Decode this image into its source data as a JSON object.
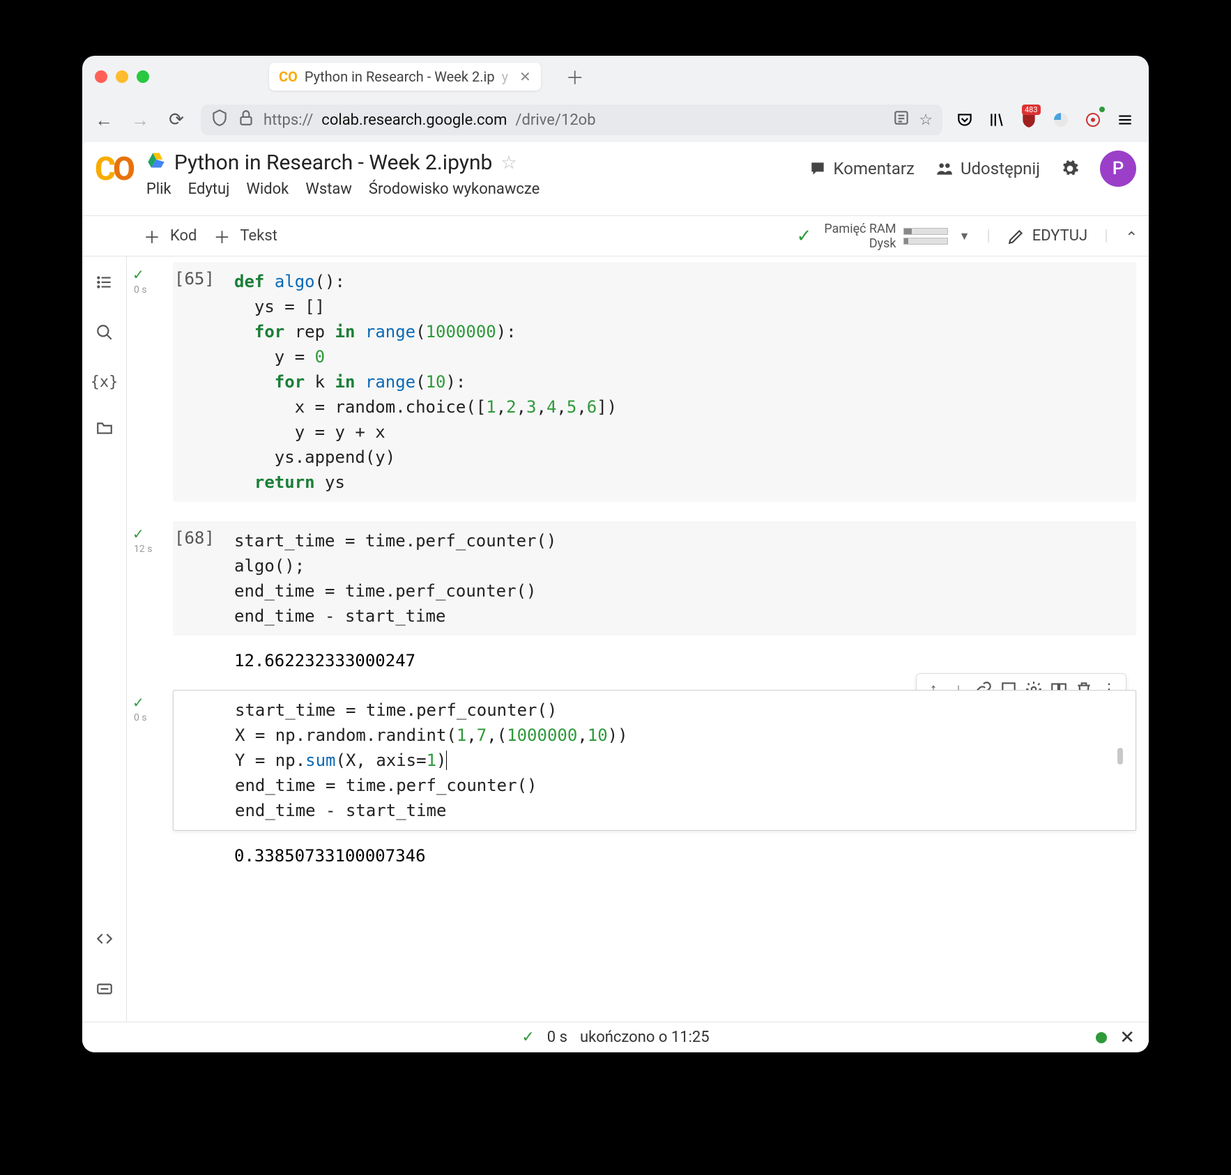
{
  "browser": {
    "tab_title": "Python in Research - Week 2.ip",
    "tab_ext": "y",
    "url_pre": "https://",
    "url_domain": "colab.research.google.com",
    "url_path": "/drive/12ob",
    "badge_count": "483"
  },
  "colab": {
    "title": "Python in Research - Week 2.ipynb",
    "menus": [
      "Plik",
      "Edytuj",
      "Widok",
      "Wstaw",
      "Środowisko wykonawcze"
    ],
    "header_actions": {
      "comment": "Komentarz",
      "share": "Udostępnij"
    },
    "avatar_letter": "P",
    "toolbar": {
      "code": "Kod",
      "text": "Tekst",
      "ram": "Pamięć RAM",
      "disk": "Dysk",
      "edit": "EDYTUJ"
    },
    "ram_fill_pct": 18,
    "disk_fill_pct": 10
  },
  "cells": [
    {
      "number": "[65]",
      "time": "0 s",
      "lines": [
        [
          [
            "kw",
            "def"
          ],
          [
            "txt",
            " "
          ],
          [
            "fn",
            "algo"
          ],
          [
            "txt",
            "():"
          ]
        ],
        [
          [
            "txt",
            "  ys = []"
          ]
        ],
        [
          [
            "txt",
            "  "
          ],
          [
            "kw",
            "for"
          ],
          [
            "txt",
            " rep "
          ],
          [
            "kw",
            "in"
          ],
          [
            "txt",
            " "
          ],
          [
            "fn",
            "range"
          ],
          [
            "txt",
            "("
          ],
          [
            "num",
            "1000000"
          ],
          [
            "txt",
            "):"
          ]
        ],
        [
          [
            "txt",
            "    y = "
          ],
          [
            "num",
            "0"
          ]
        ],
        [
          [
            "txt",
            "    "
          ],
          [
            "kw",
            "for"
          ],
          [
            "txt",
            " k "
          ],
          [
            "kw",
            "in"
          ],
          [
            "txt",
            " "
          ],
          [
            "fn",
            "range"
          ],
          [
            "txt",
            "("
          ],
          [
            "num",
            "10"
          ],
          [
            "txt",
            "):"
          ]
        ],
        [
          [
            "txt",
            "      x = random.choice(["
          ],
          [
            "num",
            "1"
          ],
          [
            "txt",
            ","
          ],
          [
            "num",
            "2"
          ],
          [
            "txt",
            ","
          ],
          [
            "num",
            "3"
          ],
          [
            "txt",
            ","
          ],
          [
            "num",
            "4"
          ],
          [
            "txt",
            ","
          ],
          [
            "num",
            "5"
          ],
          [
            "txt",
            ","
          ],
          [
            "num",
            "6"
          ],
          [
            "txt",
            "])"
          ]
        ],
        [
          [
            "txt",
            "      y = y + x"
          ]
        ],
        [
          [
            "txt",
            "    ys.append(y)"
          ]
        ],
        [
          [
            "txt",
            "  "
          ],
          [
            "kw",
            "return"
          ],
          [
            "txt",
            " ys"
          ]
        ]
      ],
      "output": null
    },
    {
      "number": "[68]",
      "time": "12 s",
      "lines": [
        [
          [
            "txt",
            "start_time = time.perf_counter()"
          ]
        ],
        [
          [
            "txt",
            "algo();"
          ]
        ],
        [
          [
            "txt",
            "end_time = time.perf_counter()"
          ]
        ],
        [
          [
            "txt",
            "end_time - start_time"
          ]
        ]
      ],
      "output": "12.662232333000247"
    },
    {
      "number": "",
      "time": "0 s",
      "active": true,
      "lines": [
        [
          [
            "txt",
            "start_time = time.perf_counter()"
          ]
        ],
        [
          [
            "txt",
            "X = np.random.randint("
          ],
          [
            "num",
            "1"
          ],
          [
            "txt",
            ","
          ],
          [
            "num",
            "7"
          ],
          [
            "txt",
            ",("
          ],
          [
            "num",
            "1000000"
          ],
          [
            "txt",
            ","
          ],
          [
            "num",
            "10"
          ],
          [
            "txt",
            "))"
          ]
        ],
        [
          [
            "txt",
            "Y = np."
          ],
          [
            "fn",
            "sum"
          ],
          [
            "txt",
            "(X, axis="
          ],
          [
            "num",
            "1"
          ],
          [
            "txt",
            ")"
          ],
          [
            "cursor",
            ""
          ]
        ],
        [
          [
            "txt",
            "end_time = time.perf_counter()"
          ]
        ],
        [
          [
            "txt",
            "end_time - start_time"
          ]
        ]
      ],
      "output": "0.33850733100007346"
    }
  ],
  "status": {
    "time": "0 s",
    "msg": "ukończono o 11:25"
  }
}
